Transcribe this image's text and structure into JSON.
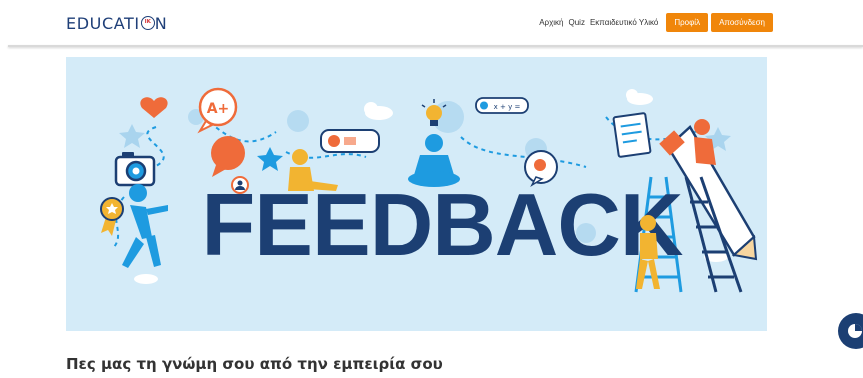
{
  "brand": {
    "logo_text_left": "EDUCATI",
    "logo_text_right": "N",
    "logo_badge": "IK"
  },
  "nav": {
    "links": [
      "Αρχική",
      "Quiz",
      "Εκπαιδευτικό Υλικό"
    ],
    "buttons": [
      "Προφίλ",
      "Αποσύνδεση"
    ]
  },
  "banner": {
    "word": "FEEDBACK",
    "grade_bubble": "A+",
    "formula_bubble": "x + y ="
  },
  "content": {
    "heading": "Πες μας τη γνώμη σου από την εμπειρία σου"
  },
  "colors": {
    "brand_navy": "#1f3f78",
    "accent_orange": "#f0860a",
    "banner_bg": "#d4ebf8",
    "illustration_blue": "#1e9be0",
    "illustration_orange": "#ef6b3a",
    "illustration_yellow": "#f2b431"
  },
  "icons": [
    "chat-widget-icon"
  ]
}
